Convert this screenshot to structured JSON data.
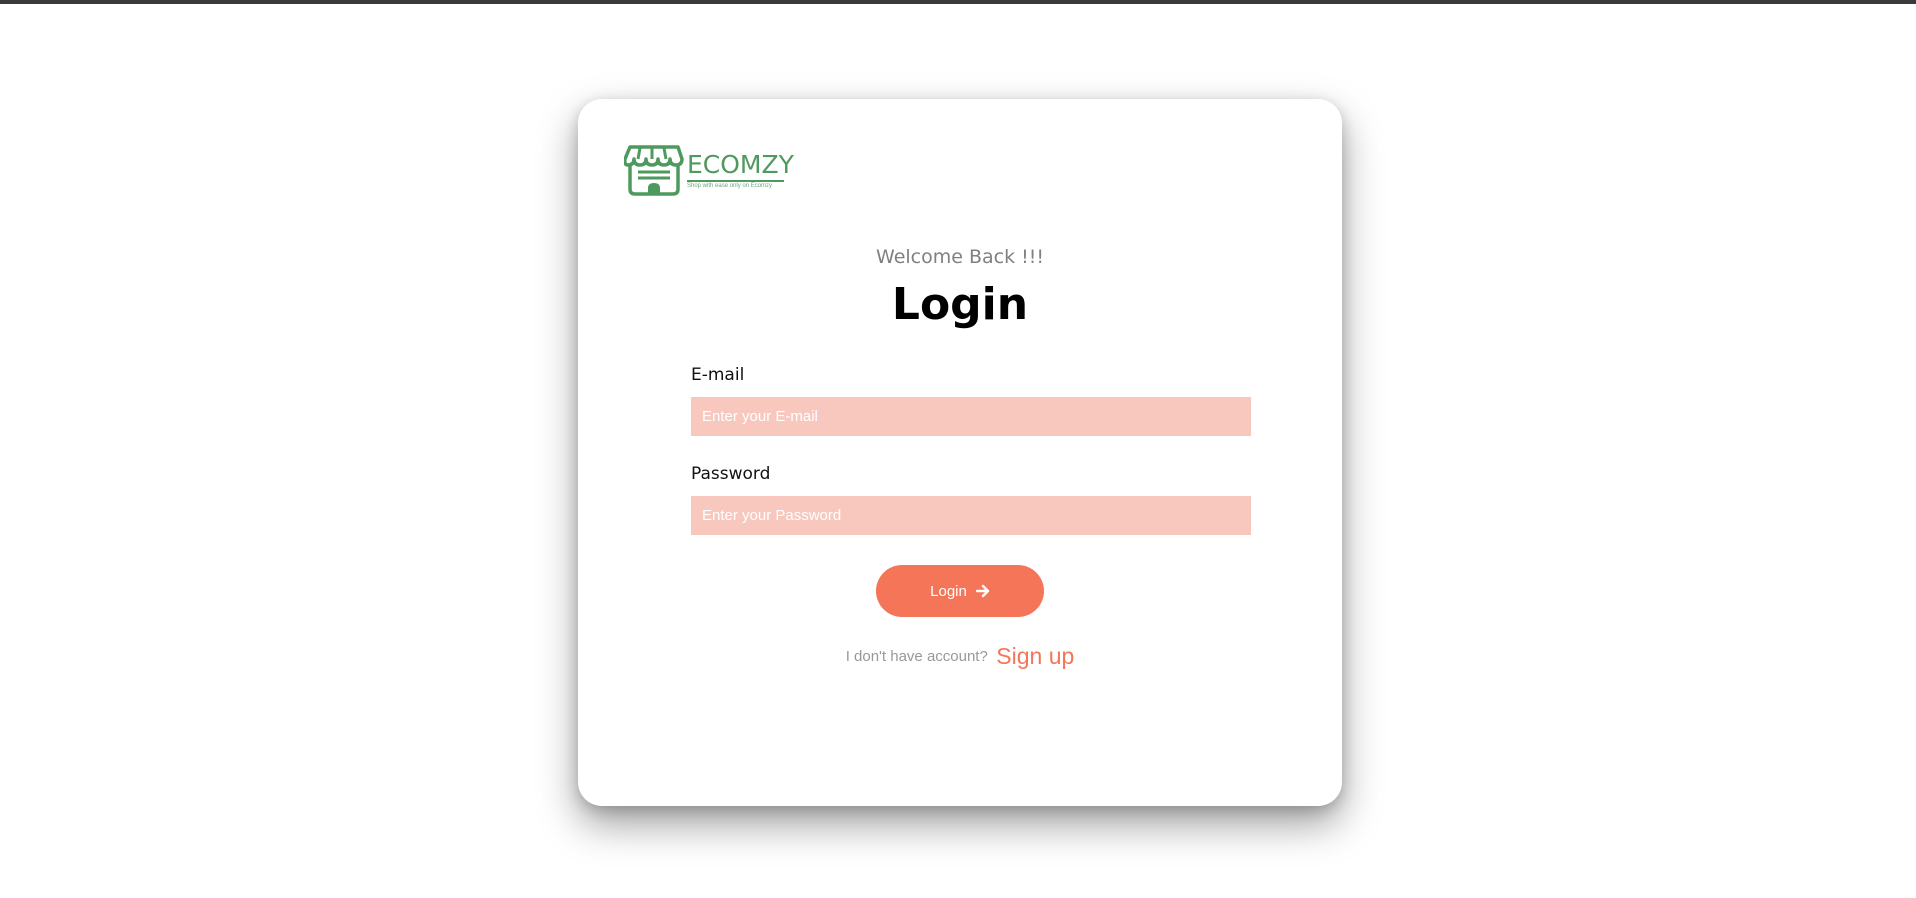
{
  "brand": {
    "name": "ECOMZY",
    "tagline": "Shop with ease only on Ecomzy",
    "color": "#4e9a5e"
  },
  "form": {
    "welcome": "Welcome Back !!!",
    "title": "Login",
    "email": {
      "label": "E-mail",
      "placeholder": "Enter your E-mail",
      "value": ""
    },
    "password": {
      "label": "Password",
      "placeholder": "Enter your Password",
      "value": ""
    },
    "submit_label": "Login",
    "submit_icon": "arrow-right-icon",
    "signup_prompt": "I don't have account?",
    "signup_link": "Sign up"
  },
  "colors": {
    "accent": "#f47558",
    "input_bg": "#f8c8be",
    "topbar": "#3a3a3a"
  }
}
